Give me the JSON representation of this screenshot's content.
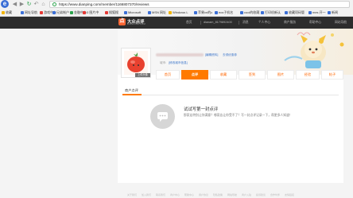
{
  "browser": {
    "url": "https://www.dianping.com/member/1166807370/reviews",
    "bookmarks": [
      {
        "label": "收藏",
        "color": "#f2b400"
      },
      {
        "label": "网址导航",
        "color": "#3b6fd6"
      },
      {
        "label": "游戏中心",
        "color": "#e53935"
      },
      {
        "label": "兄弟帐户",
        "color": "#3b6fd6"
      },
      {
        "label": "金融中心",
        "color": "#2ba24c"
      },
      {
        "label": "3 图片中",
        "color": "#e53935"
      },
      {
        "label": "搜狐搜",
        "color": "#e53935"
      },
      {
        "label": "Microsoft",
        "color": "#3b6fd6"
      },
      {
        "label": "MSN 网址",
        "color": "#3b6fd6"
      },
      {
        "label": "Windows L",
        "color": "#f2b400"
      },
      {
        "label": "苹果cn的c",
        "color": "#3b6fd6"
      },
      {
        "label": "ecs子机名",
        "color": "#3b6fd6"
      },
      {
        "label": "cooi的收蔵",
        "color": "#3b6fd6"
      },
      {
        "label": "打印机新认",
        "color": "#3b6fd6"
      },
      {
        "label": "收藏项码管",
        "color": "#3b6fd6"
      },
      {
        "label": "mes 开一",
        "color": "#3b6fd6"
      },
      {
        "label": "新闻",
        "color": "#3b6fd6"
      }
    ]
  },
  "header": {
    "brand_mark": "点",
    "brand_name": "大众点评",
    "brand_sub": "DIANPING.COM",
    "links": [
      "首页",
      "dianam_8179892400",
      "消息",
      "个人中心",
      "商户服务",
      "帮助中心",
      "网站导航"
    ]
  },
  "profile": {
    "upload_avatar": "上传头像",
    "verify_link": "[编辑资料]",
    "more_link": "去领优惠券",
    "city_label": "城市:",
    "city_edit": "[修改城市信息]"
  },
  "tabs": [
    "首页",
    "点评",
    "收藏",
    "签到",
    "图片",
    "经验",
    "帖子"
  ],
  "active_tab": 1,
  "section_title": "商户点评",
  "empty": {
    "title": "试试写第一封点评",
    "desc": "那家店特别让你满意？哪家店让你受不了？写一封点评记录一下，帮更多人知道！"
  },
  "footer_links": [
    "关于我们",
    "加入我们",
    "联系我们",
    "商户中心",
    "帮助中心",
    "用户协议",
    "隐私政策",
    "网站导航",
    "商户入驻",
    "投诉建议",
    "合作伙伴",
    "友情链接"
  ],
  "colors": {
    "accent": "#ff7a00",
    "header_bg": "#2d2d2d",
    "link": "#3a74c9"
  }
}
